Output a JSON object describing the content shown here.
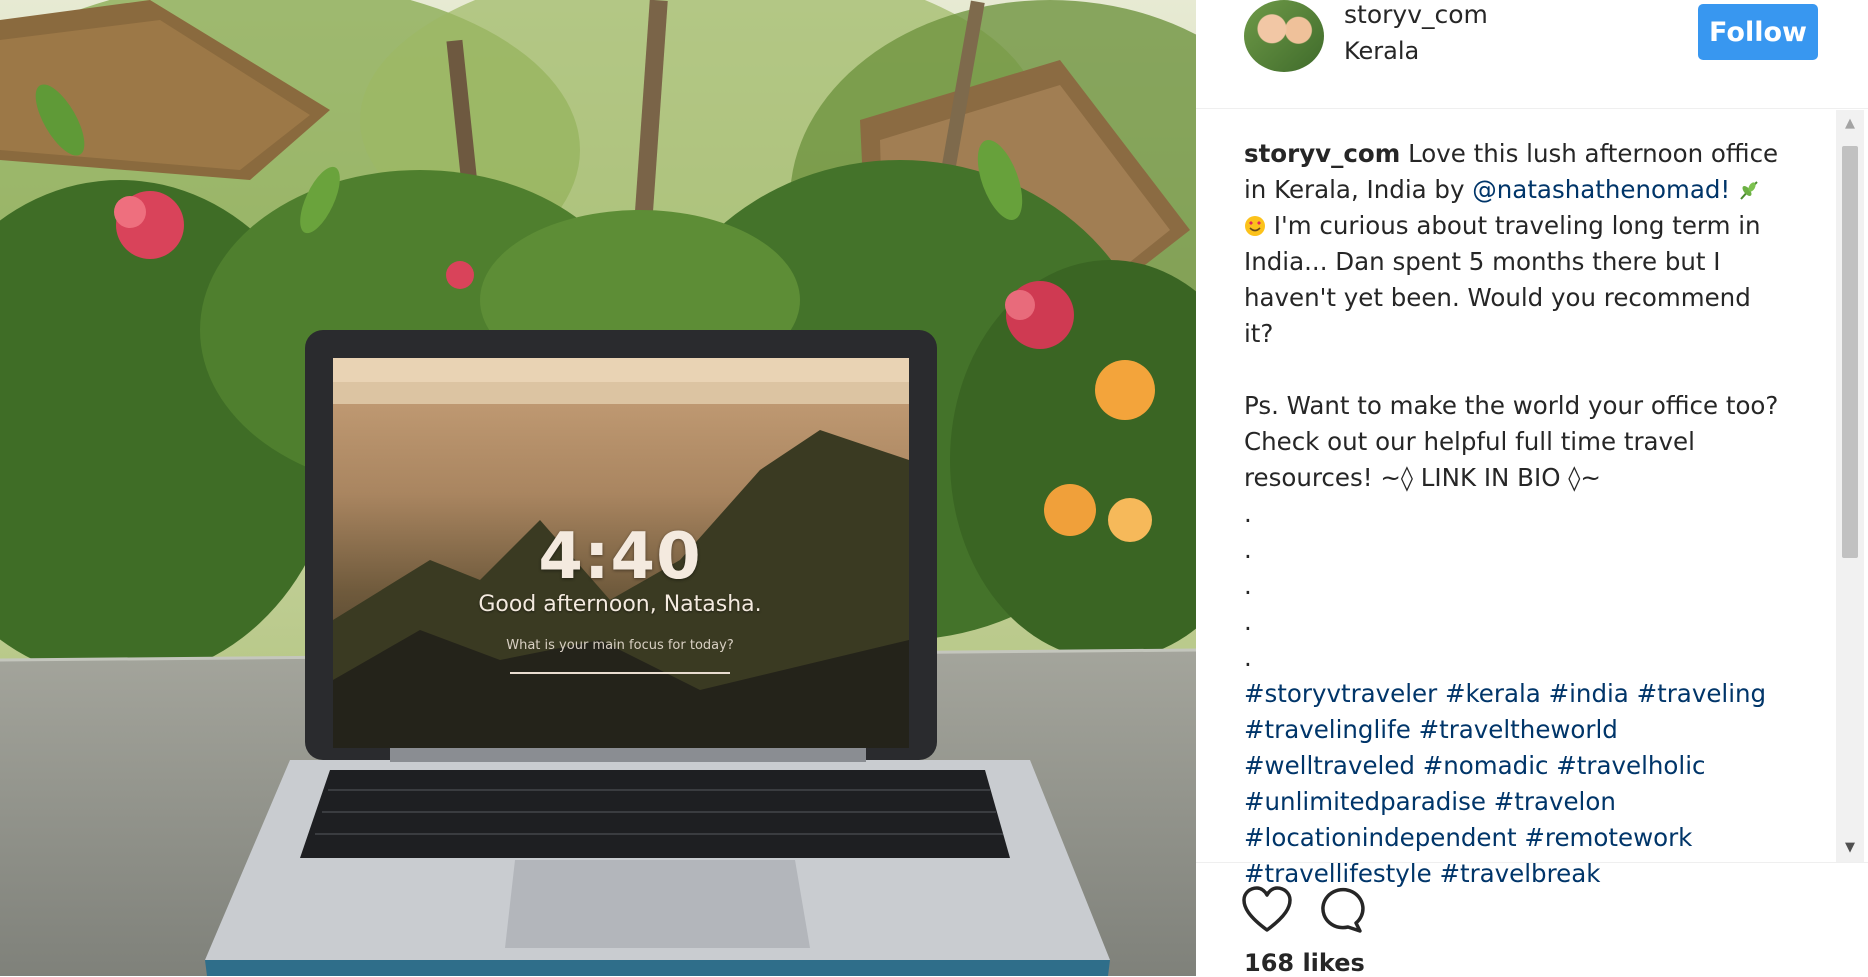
{
  "photo": {
    "clock": "4:40",
    "greeting": "Good afternoon, Natasha.",
    "focus_question": "What is your main focus for today?"
  },
  "post": {
    "username": "storyv_com",
    "location": "Kerala",
    "follow_label": "Follow",
    "caption_user": "storyv_com",
    "caption_part1": " Love this lush afternoon office in Kerala, India by ",
    "caption_mention": "@natashathenomad!",
    "caption_part2": " I'm curious about traveling long term in India... Dan spent 5 months there but I haven't yet been. Would you recommend it?",
    "caption_ps": "Ps. Want to make the world your office too? Check out our helpful full time travel resources! ~◊ LINK IN BIO ◊~",
    "dots": [
      ".",
      ".",
      ".",
      ".",
      "."
    ],
    "hashtags": "#storyvtraveler #kerala #india #traveling #travelinglife #traveltheworld #welltraveled #nomadic #travelholic #unlimitedparadise #travelon #locationindependent #remotework #travellifestyle #travelbreak",
    "likes": "168 likes"
  },
  "icons": {
    "like": "heart-icon",
    "comment": "comment-icon",
    "leaf": "herb-emoji",
    "smile": "heart-eyes-emoji"
  }
}
